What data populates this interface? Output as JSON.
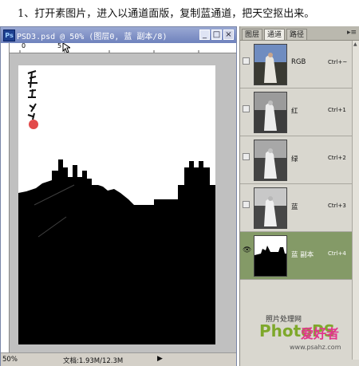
{
  "caption": "1、打开素图片，进入以通道面版，复制蓝通道，把天空抠出来。",
  "document": {
    "title": "PSD3.psd @ 50% (图层0, 蓝 副本/8)",
    "app_icon": "Ps",
    "ruler_label_0": "0",
    "ruler_label_5": "5",
    "zoom": "50%",
    "doc_size": "文档:1.93M/12.3M",
    "buttons": {
      "minimize": "_",
      "maximize": "□",
      "close": "×"
    },
    "colors": {
      "titlebar": "#6f82bd",
      "canvas_bg": "#c0c0c0",
      "silhouette": "#000000"
    }
  },
  "panel": {
    "tabs": [
      "图层",
      "通道",
      "路径"
    ],
    "active_tab": "通道",
    "channels": [
      {
        "name": "RGB",
        "shortcut": "Ctrl+~"
      },
      {
        "name": "红",
        "shortcut": "Ctrl+1"
      },
      {
        "name": "绿",
        "shortcut": "Ctrl+2"
      },
      {
        "name": "蓝",
        "shortcut": "Ctrl+3"
      },
      {
        "name": "蓝 副本",
        "shortcut": "Ctrl+4"
      }
    ],
    "selected_channel": "蓝 副本",
    "selected_color": "#849a67"
  },
  "watermark": {
    "top": "照片处理网",
    "brand": "PhotoPS",
    "cn": "爱好者",
    "url": "www.psahz.com"
  }
}
